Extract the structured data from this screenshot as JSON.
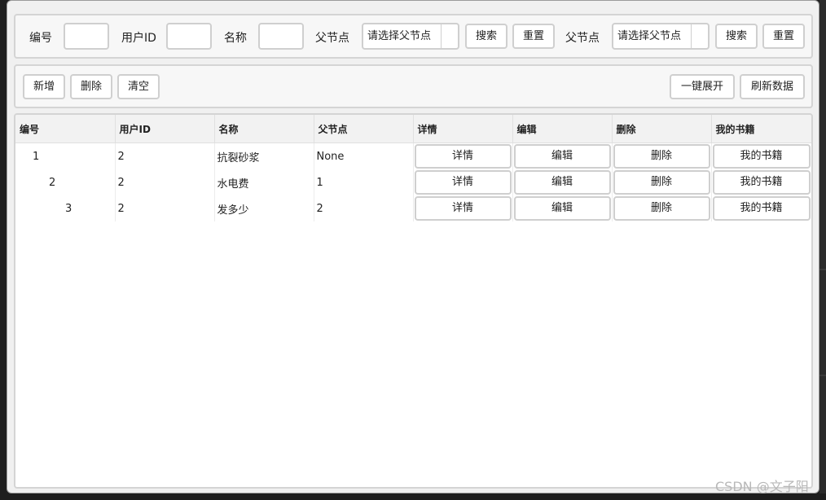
{
  "search": {
    "id_label": "编号",
    "userid_label": "用户ID",
    "name_label": "名称",
    "parent_label": "父节点",
    "parent_select_placeholder": "请选择父节点",
    "search_button": "搜索",
    "reset_button": "重置",
    "parent_label_2": "父节点",
    "parent_select_placeholder_2": "请选择父节点",
    "search_button_2": "搜索",
    "reset_button_2": "重置"
  },
  "toolbar": {
    "add_button": "新增",
    "delete_button": "删除",
    "clear_button": "清空",
    "expand_all_button": "一键展开",
    "refresh_button": "刷新数据"
  },
  "table": {
    "columns": [
      "编号",
      "用户ID",
      "名称",
      "父节点",
      "详情",
      "编辑",
      "删除",
      "我的书籍"
    ],
    "rows": [
      {
        "id": "1",
        "userid": "2",
        "name": "抗裂砂浆",
        "parent": "None",
        "detail": "详情",
        "edit": "编辑",
        "delete": "删除",
        "books": "我的书籍"
      },
      {
        "id": "2",
        "userid": "2",
        "name": "水电费",
        "parent": "1",
        "detail": "详情",
        "edit": "编辑",
        "delete": "删除",
        "books": "我的书籍"
      },
      {
        "id": "3",
        "userid": "2",
        "name": "发多少",
        "parent": "2",
        "detail": "详情",
        "edit": "编辑",
        "delete": "删除",
        "books": "我的书籍"
      }
    ]
  },
  "watermark": "CSDN @文子阳"
}
